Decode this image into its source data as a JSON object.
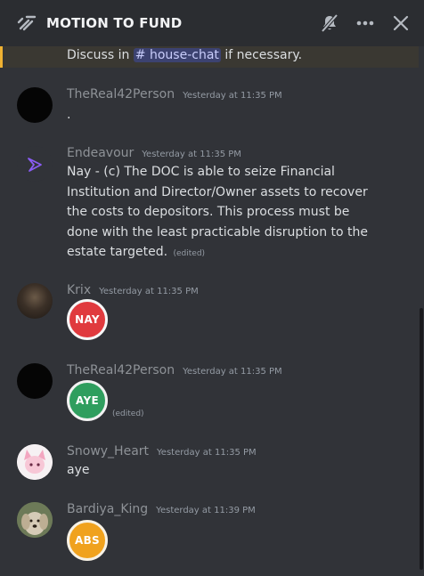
{
  "header": {
    "title": "MOTION TO FUND",
    "icons": {
      "thread": "thread-icon",
      "mute": "bell-slash-icon",
      "more": "more-icon",
      "close": "close-icon"
    }
  },
  "highlight": {
    "prefix": "Discuss in ",
    "channel_mention": "# house-chat",
    "suffix": " if necessary."
  },
  "messages": [
    {
      "username": "TheReal42Person",
      "timestamp": "Yesterday at 11:35 PM",
      "text": "."
    },
    {
      "username": "Endeavour",
      "timestamp": "Yesterday at 11:35 PM",
      "text": "Nay - (c) The DOC is able to seize Financial Institution and Director/Owner assets to recover the costs to depositors. This process must be done with the least practicable disruption to the estate targeted.",
      "edited": "(edited)"
    },
    {
      "username": "Krix",
      "timestamp": "Yesterday at 11:35 PM",
      "vote": "NAY",
      "vote_color": "#e03a3e"
    },
    {
      "username": "TheReal42Person",
      "timestamp": "Yesterday at 11:35 PM",
      "vote": "AYE",
      "vote_color": "#2f9e5e",
      "edited": "(edited)"
    },
    {
      "username": "Snowy_Heart",
      "timestamp": "Yesterday at 11:35 PM",
      "text": "aye"
    },
    {
      "username": "Bardiya_King",
      "timestamp": "Yesterday at 11:39 PM",
      "vote": "ABS",
      "vote_color": "#f0a21e"
    }
  ]
}
